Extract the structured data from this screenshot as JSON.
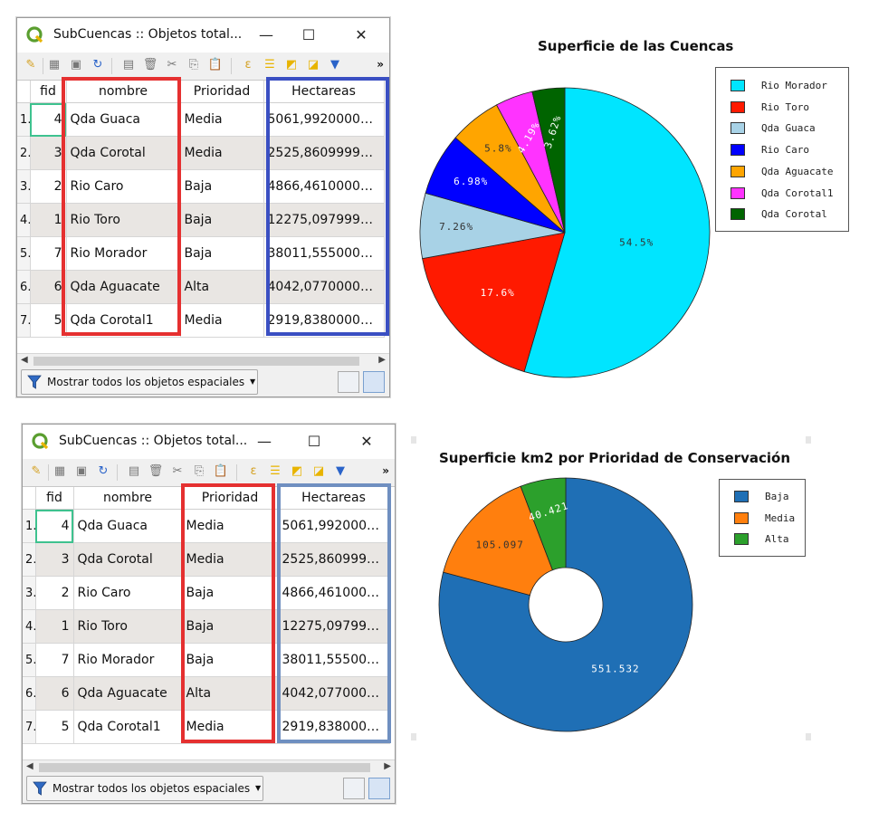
{
  "windows": [
    {
      "title": "SubCuencas :: Objetos total...",
      "columns": [
        "fid",
        "nombre",
        "Prioridad",
        "Hectareas"
      ],
      "rows": [
        {
          "row": "1",
          "fid": "4",
          "nombre": "Qda Guaca",
          "prioridad": "Media",
          "hectareas": "5061,99200000..."
        },
        {
          "row": "2",
          "fid": "3",
          "nombre": "Qda Corotal",
          "prioridad": "Media",
          "hectareas": "2525,86099999..."
        },
        {
          "row": "3",
          "fid": "2",
          "nombre": "Rio Caro",
          "prioridad": "Baja",
          "hectareas": "4866,46100000..."
        },
        {
          "row": "4",
          "fid": "1",
          "nombre": "Rio Toro",
          "prioridad": "Baja",
          "hectareas": "12275,0979999..."
        },
        {
          "row": "5",
          "fid": "7",
          "nombre": "Rio Morador",
          "prioridad": "Baja",
          "hectareas": "38011,5550000..."
        },
        {
          "row": "6",
          "fid": "6",
          "nombre": "Qda Aguacate",
          "prioridad": "Alta",
          "hectareas": "4042,07700000..."
        },
        {
          "row": "7",
          "fid": "5",
          "nombre": "Qda Corotal1",
          "prioridad": "Media",
          "hectareas": "2919,83800000..."
        }
      ],
      "filter_label": "Mostrar todos los objetos espaciales",
      "more": "»"
    },
    {
      "title": "SubCuencas :: Objetos total...",
      "columns": [
        "fid",
        "nombre",
        "Prioridad",
        "Hectareas"
      ],
      "rows": [
        {
          "row": "1",
          "fid": "4",
          "nombre": "Qda Guaca",
          "prioridad": "Media",
          "hectareas": "5061,99200000..."
        },
        {
          "row": "2",
          "fid": "3",
          "nombre": "Qda Corotal",
          "prioridad": "Media",
          "hectareas": "2525,86099999..."
        },
        {
          "row": "3",
          "fid": "2",
          "nombre": "Rio Caro",
          "prioridad": "Baja",
          "hectareas": "4866,46100000..."
        },
        {
          "row": "4",
          "fid": "1",
          "nombre": "Rio Toro",
          "prioridad": "Baja",
          "hectareas": "12275,0979999..."
        },
        {
          "row": "5",
          "fid": "7",
          "nombre": "Rio Morador",
          "prioridad": "Baja",
          "hectareas": "38011,5550000..."
        },
        {
          "row": "6",
          "fid": "6",
          "nombre": "Qda Aguacate",
          "prioridad": "Alta",
          "hectareas": "4042,07700000..."
        },
        {
          "row": "7",
          "fid": "5",
          "nombre": "Qda Corotal1",
          "prioridad": "Media",
          "hectareas": "2919,83800000..."
        }
      ],
      "filter_label": "Mostrar todos los objetos espaciales",
      "more": "»"
    }
  ],
  "icons": [
    "qgis-logo-icon",
    "minimize-icon",
    "maximize-icon",
    "close-icon",
    "pencil-icon",
    "multi-edit-icon",
    "save-icon",
    "reload-icon",
    "add-feature-icon",
    "delete-feature-icon",
    "cut-icon",
    "copy-icon",
    "paste-icon",
    "select-expression-icon",
    "select-all-icon",
    "invert-selection-icon",
    "deselect-icon",
    "filter-icon",
    "form-view-icon",
    "table-view-icon"
  ],
  "highlight_colors": {
    "red": "#e53030",
    "blue": "#3a4fc2",
    "steel": "#6f8fc0"
  },
  "chart_data": [
    {
      "type": "pie",
      "title": "Superficie de las Cuencas",
      "categories": [
        "Rio Morador",
        "Rio Toro",
        "Qda Guaca",
        "Rio Caro",
        "Qda Aguacate",
        "Qda Corotal1",
        "Qda Corotal"
      ],
      "values": [
        54.5,
        17.6,
        7.26,
        6.98,
        5.8,
        4.19,
        3.62
      ],
      "labels": [
        "54.5%",
        "17.6%",
        "7.26%",
        "6.98%",
        "5.8%",
        "4.19%",
        "3.62%"
      ],
      "colors": [
        "#00e5ff",
        "#ff1a00",
        "#a8d2e6",
        "#0000ff",
        "#ffa500",
        "#ff33ff",
        "#006400"
      ],
      "legend_position": "top-right"
    },
    {
      "type": "pie",
      "donut": true,
      "title": "Superficie km2 por Prioridad de Conservación",
      "categories": [
        "Baja",
        "Media",
        "Alta"
      ],
      "values": [
        551.532,
        105.097,
        40.421
      ],
      "labels": [
        "551.532",
        "105.097",
        "40.421"
      ],
      "colors": [
        "#1f6fb5",
        "#ff7f0e",
        "#2ca02c"
      ],
      "legend_position": "top-right"
    }
  ]
}
